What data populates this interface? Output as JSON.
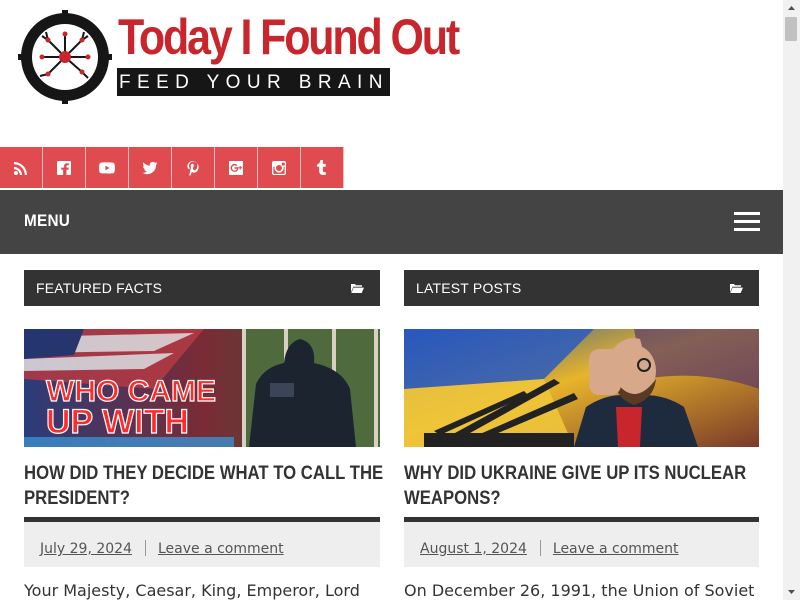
{
  "header": {
    "logo_title": "Today I Found Out",
    "logo_tagline": "FEED YOUR BRAIN"
  },
  "social_icons": [
    "rss-icon",
    "facebook-icon",
    "youtube-icon",
    "twitter-icon",
    "pinterest-icon",
    "google-plus-icon",
    "instagram-icon",
    "tumblr-icon"
  ],
  "nav": {
    "menu_label": "MENU"
  },
  "featured": {
    "widget_title": "FEATURED FACTS",
    "thumb_text_line1": "WHO CAME",
    "thumb_text_line2": "UP WITH",
    "post_title": "HOW DID THEY DECIDE WHAT TO CALL THE PRESIDENT?",
    "date": "July 29, 2024",
    "comment_link": "Leave a comment",
    "excerpt": "Your Majesty, Caesar, King, Emperor, Lord"
  },
  "latest": {
    "widget_title": "LATEST POSTS",
    "post_title": "WHY DID UKRAINE GIVE UP ITS NUCLEAR WEAPONS?",
    "date": "August 1, 2024",
    "comment_link": "Leave a comment",
    "excerpt": "On December 26, 1991, the Union of Soviet"
  },
  "colors": {
    "brand_red": "#c8262c",
    "social_red": "#e04b50",
    "nav_gray": "#444444",
    "widget_header": "#333333"
  }
}
